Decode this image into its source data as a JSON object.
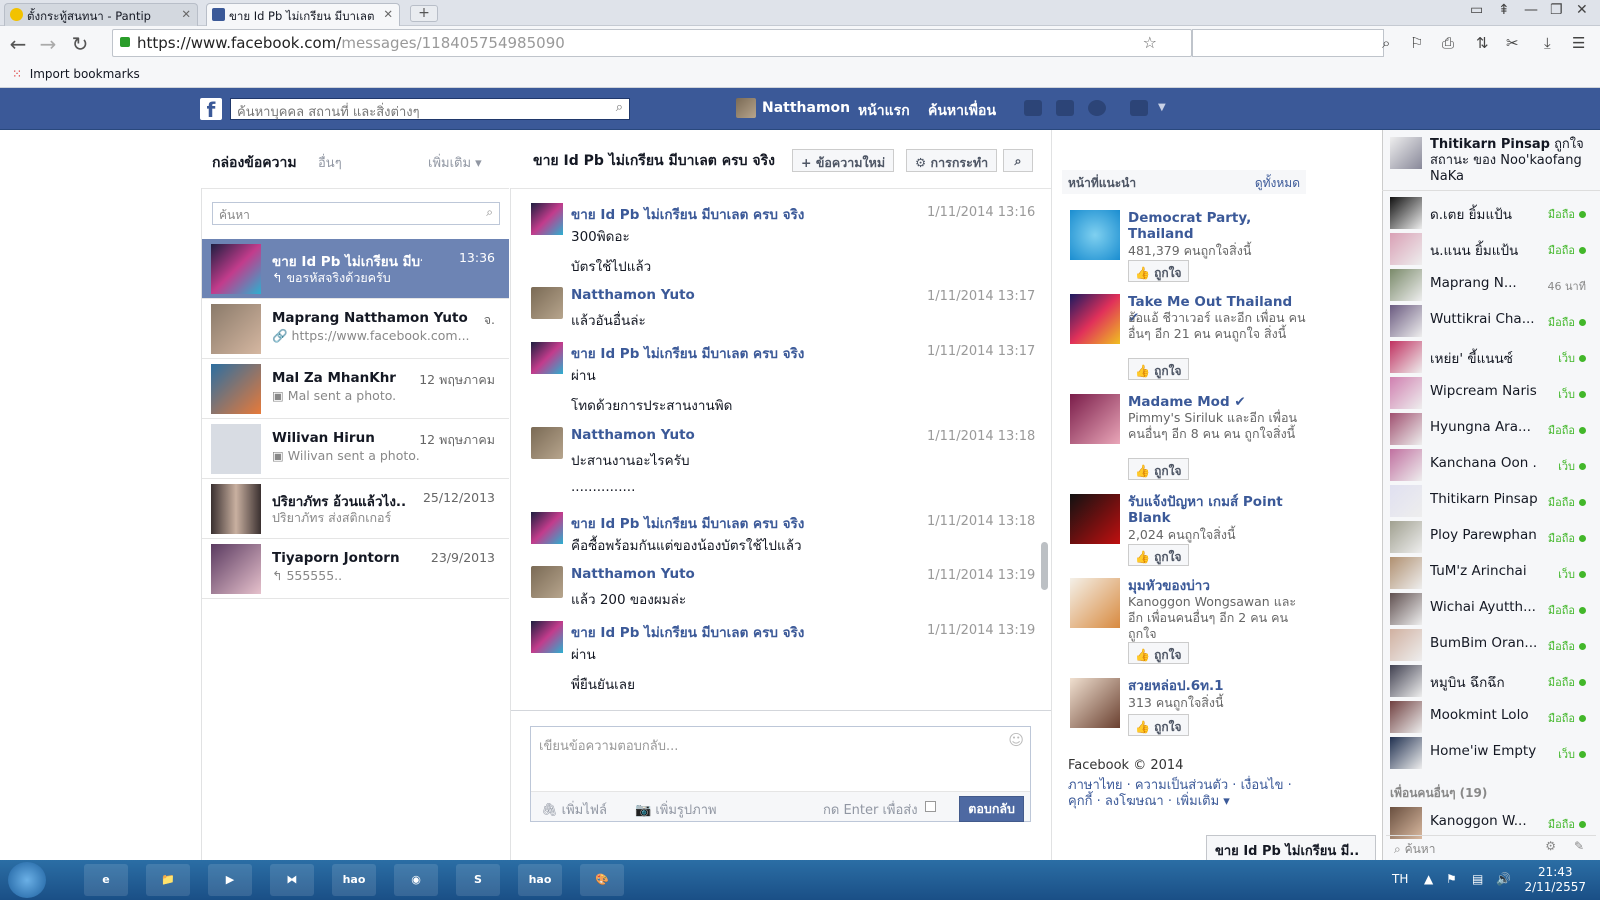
{
  "browser": {
    "tabs": [
      {
        "title": "ตั้งกระทู้สนทนา - Pantip"
      },
      {
        "title": "ขาย Id Pb ไม่เกรียน มีบาเลต"
      }
    ],
    "url_host": "https://www.facebook.com/",
    "url_path": "messages/118405754985090",
    "bookmark": "Import bookmarks"
  },
  "fb_header": {
    "search_placeholder": "ค้นหาบุคคล สถานที่ และสิ่งต่างๆ",
    "user": "Natthamon",
    "home": "หน้าแรก",
    "find_friends": "ค้นหาเพื่อน"
  },
  "inbox": {
    "title": "กล่องข้อความ",
    "other": "อื่นๆ",
    "more": "เพิ่มเติม ▾",
    "search_placeholder": "ค้นหา",
    "threads": [
      {
        "name": "ขาย Id Pb ไม่เกรียน มีบาเล..",
        "time": "13:36",
        "snippet": "↰ ขอรหัสจริงด้วยครับ"
      },
      {
        "name": "Maprang Natthamon Yuto",
        "time": "จ.",
        "snippet": "🔗 https://www.facebook.com..."
      },
      {
        "name": "Mal Za MhanKhr",
        "time": "12 พฤษภาคม",
        "snippet": "▣ Mal sent a photo."
      },
      {
        "name": "Wilivan Hirun",
        "time": "12 พฤษภาคม",
        "snippet": "▣ Wilivan sent a photo."
      },
      {
        "name": "ปริยาภัทร อ้วนแล้วไง..",
        "time": "25/12/2013",
        "snippet": "ปริยาภัทร ส่งสติกเกอร์"
      },
      {
        "name": "Tiyaporn Jontorn",
        "time": "23/9/2013",
        "snippet": "↰ 555555.."
      }
    ]
  },
  "conversation": {
    "title": "ขาย Id Pb ไม่เกรียน มีบาเลต ครบ จริง",
    "new_message": "+ ข้อความใหม่",
    "actions": "⚙ การกระทำ",
    "messages": [
      {
        "sender": "ขาย Id Pb ไม่เกรียน มีบาเลต ครบ จริง",
        "time": "1/11/2014 13:16",
        "lines": [
          "300พิดอะ",
          "บัตรใช้ไปแล้ว"
        ]
      },
      {
        "sender": "Natthamon Yuto",
        "time": "1/11/2014 13:17",
        "lines": [
          "แล้วอันอื่นล่ะ"
        ]
      },
      {
        "sender": "ขาย Id Pb ไม่เกรียน มีบาเลต ครบ จริง",
        "time": "1/11/2014 13:17",
        "lines": [
          "ผ่าน",
          "โทดด้วยการประสานงานพิด"
        ]
      },
      {
        "sender": "Natthamon Yuto",
        "time": "1/11/2014 13:18",
        "lines": [
          "ปะสานงานอะไรครับ",
          "..............."
        ]
      },
      {
        "sender": "ขาย Id Pb ไม่เกรียน มีบาเลต ครบ จริง",
        "time": "1/11/2014 13:18",
        "lines": [
          "คือซื้อพร้อมกันแต่ของน้องบัตรใช้ไปแล้ว"
        ]
      },
      {
        "sender": "Natthamon Yuto",
        "time": "1/11/2014 13:19",
        "lines": [
          "แล้ว 200 ของผมล่ะ"
        ]
      },
      {
        "sender": "ขาย Id Pb ไม่เกรียน มีบาเลต ครบ จริง",
        "time": "1/11/2014 13:19",
        "lines": [
          "ผ่าน",
          "พี่ยืนยันเลย"
        ]
      }
    ],
    "reply_placeholder": "เขียนข้อความตอบกลับ...",
    "attach_file": "เพิ่มไฟล์",
    "attach_photo": "เพิ่มรูปภาพ",
    "enter_to_send": "กด Enter เพื่อส่ง",
    "send": "ตอบกลับ"
  },
  "suggested": {
    "header": "หน้าที่แนะนำ",
    "see_all": "ดูทั้งหมด",
    "like": "👍 ถูกใจ",
    "pages": [
      {
        "name": "Democrat Party, Thailand",
        "desc": "481,379 คนถูกใจสิ่งนี้"
      },
      {
        "name": "Take Me Out Thailand ✔",
        "desc": "อ้อแอ้ ชีวาเวอร์ และอีก เพื่อน คนอื่นๆ อีก 21 คน คนถูกใจ สิ่งนี้"
      },
      {
        "name": "Madame Mod ✔",
        "desc": "Pimmy's Siriluk และอีก เพื่อนคนอื่นๆ อีก 8 คน คน ถูกใจสิ่งนี้"
      },
      {
        "name": "รับแจ้งปัญหา เกมส์ Point Blank",
        "desc": "2,024 คนถูกใจสิ่งนี้"
      },
      {
        "name": "มุมหัวของบ่าว",
        "desc": "Kanoggon Wongsawan และอีก เพื่อนคนอื่นๆ อีก 2 คน คนถูกใจ"
      },
      {
        "name": "สวยหล่อป.6ท.1",
        "desc": "313 คนถูกใจสิ่งนี้"
      }
    ],
    "footer_copyright": "Facebook © 2014",
    "footer_links": "ภาษาไทย · ความเป็นส่วนตัว · เงื่อนไข · คุกกี้ · ลงโฆษณา · เพิ่มเติม ▾"
  },
  "chat_dock": "ขาย Id Pb ไม่เกรียน มี..",
  "sidebar": {
    "ticker_name": "Thitikarn Pinsap",
    "ticker_text": "ถูกใจ สถานะ ของ Noo'kaofang NaKa",
    "friends": [
      {
        "name": "ด.เตย ยิ้มแป้น",
        "status": "มือถือ",
        "state": "on"
      },
      {
        "name": "น.แนน ยิ้มแป้น",
        "status": "มือถือ",
        "state": "on"
      },
      {
        "name": "Maprang N...",
        "status": "46 นาที",
        "state": "idle"
      },
      {
        "name": "Wuttikrai Cha...",
        "status": "มือถือ",
        "state": "on"
      },
      {
        "name": "เหย่ย' ขี้แนนซ์",
        "status": "เว็บ",
        "state": "on"
      },
      {
        "name": "Wipcream Naris...",
        "status": "เว็บ",
        "state": "on"
      },
      {
        "name": "Hyungna Ara...",
        "status": "มือถือ",
        "state": "on"
      },
      {
        "name": "Kanchana Oon ...",
        "status": "เว็บ",
        "state": "on"
      },
      {
        "name": "Thitikarn Pinsap",
        "status": "มือถือ",
        "state": "on"
      },
      {
        "name": "Ploy Parewphan",
        "status": "มือถือ",
        "state": "on"
      },
      {
        "name": "TuM'z Arinchai",
        "status": "เว็บ",
        "state": "on"
      },
      {
        "name": "Wichai Ayutth...",
        "status": "มือถือ",
        "state": "on"
      },
      {
        "name": "BumBim Oran...",
        "status": "มือถือ",
        "state": "on"
      },
      {
        "name": "หมูบิน ฉึกฉึก",
        "status": "มือถือ",
        "state": "on"
      },
      {
        "name": "Mookmint Lolo",
        "status": "มือถือ",
        "state": "on"
      },
      {
        "name": "Home'iw Empty",
        "status": "เว็บ",
        "state": "on"
      }
    ],
    "other_friends": "เพื่อนคนอื่นๆ (19)",
    "other_friend": {
      "name": "Kanoggon W...",
      "status": "มือถือ"
    },
    "search": "ค้นหา"
  },
  "taskbar": {
    "lang": "TH",
    "time": "21:43",
    "date": "2/11/2557",
    "apps": [
      "e",
      "📁",
      "▶",
      "⧓",
      "hao 123",
      "◉",
      "S",
      "hao 123",
      "🎨"
    ]
  }
}
